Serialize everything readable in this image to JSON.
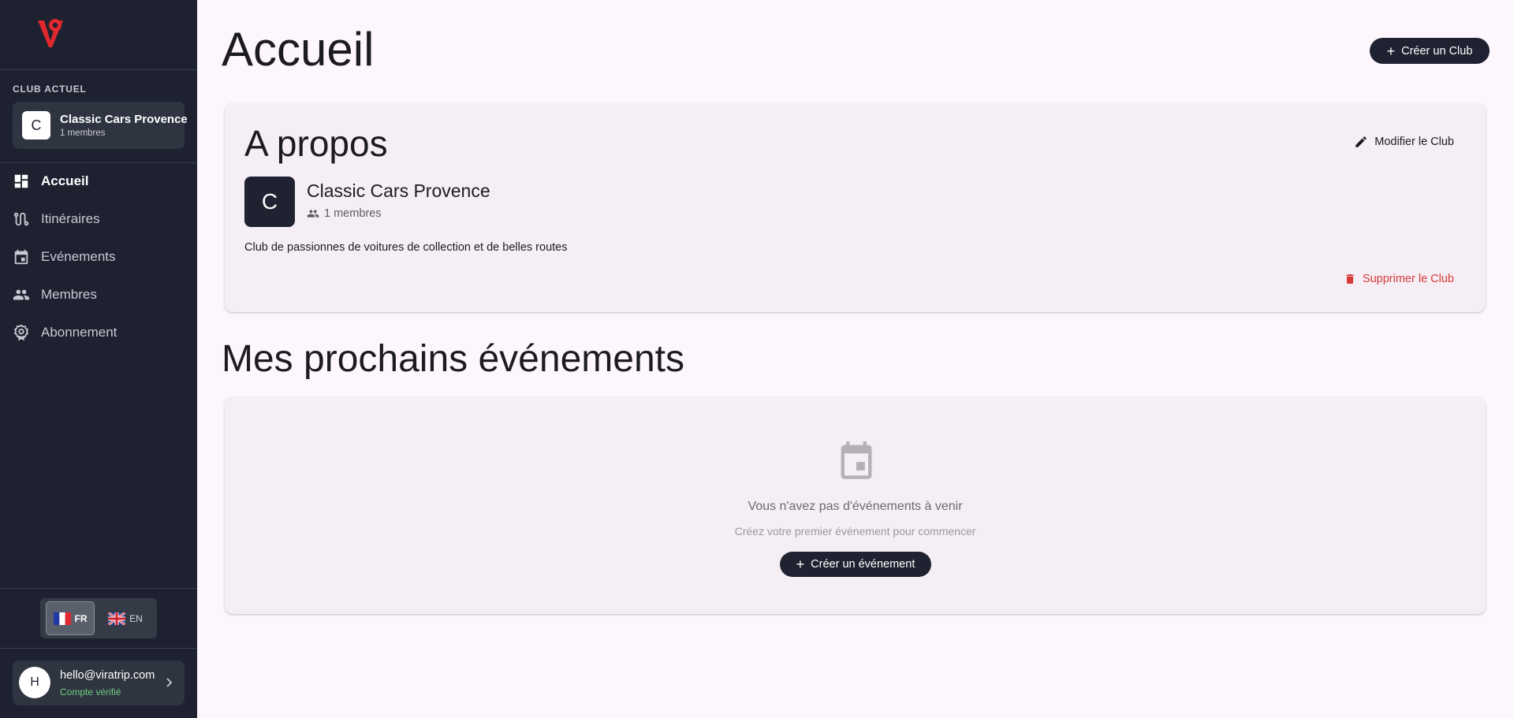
{
  "sidebar": {
    "current_club_caption": "CLUB ACTUEL",
    "club": {
      "initial": "C",
      "name": "Classic Cars Provence",
      "members": "1 membres"
    },
    "nav": [
      {
        "label": "Accueil",
        "icon": "dashboard-icon",
        "active": true
      },
      {
        "label": "Itinéraires",
        "icon": "route-icon",
        "active": false
      },
      {
        "label": "Evénements",
        "icon": "calendar-icon",
        "active": false
      },
      {
        "label": "Membres",
        "icon": "people-icon",
        "active": false
      },
      {
        "label": "Abonnement",
        "icon": "badge-icon",
        "active": false
      }
    ],
    "languages": [
      {
        "code": "FR",
        "flag": "france-flag-icon",
        "active": true
      },
      {
        "code": "EN",
        "flag": "uk-flag-icon",
        "active": false
      }
    ],
    "user": {
      "initial": "H",
      "email": "hello@viratrip.com",
      "status": "Compte vérifié"
    }
  },
  "header": {
    "title": "Accueil",
    "create_club_label": "Créer un Club"
  },
  "about": {
    "title": "A propos",
    "modify_label": "Modifier le Club",
    "club_initial": "C",
    "club_name": "Classic Cars Provence",
    "members": "1 membres",
    "description": "Club de passionnes de voitures de collection et de belles routes",
    "delete_label": "Supprimer le Club"
  },
  "events": {
    "title": "Mes prochains événements",
    "empty_title": "Vous n'avez pas d'événements à venir",
    "empty_subtitle": "Créez votre premier événement pour commencer",
    "create_label": "Créer un événement"
  },
  "colors": {
    "sidebar_bg": "#1e2230",
    "accent_dark": "#1f2230",
    "danger": "#d83a3a",
    "verified": "#6fcf7e",
    "logo_red": "#e0282e"
  }
}
